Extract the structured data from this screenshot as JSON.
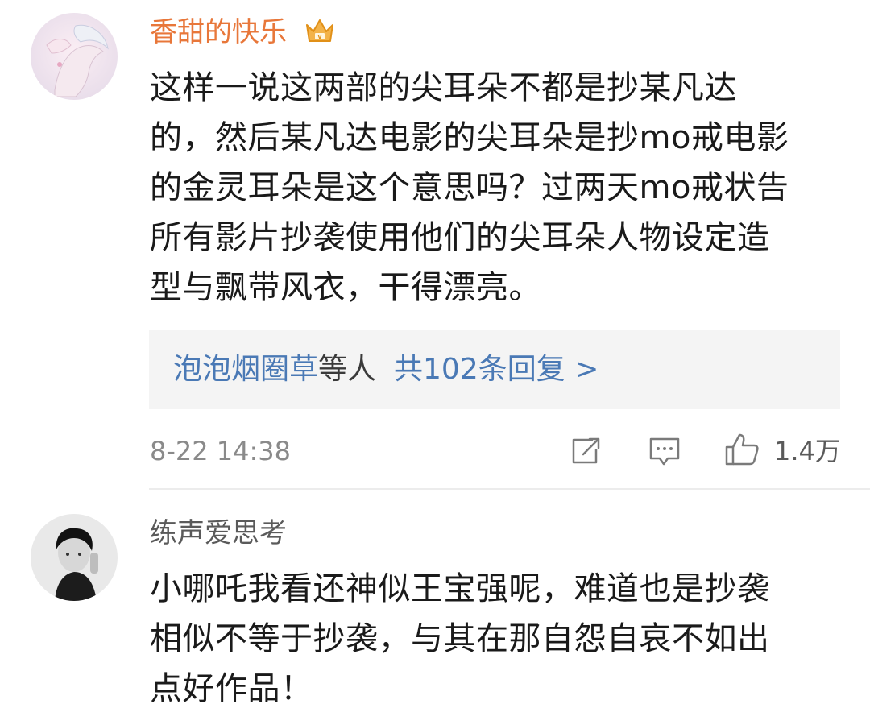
{
  "comments": [
    {
      "username": "香甜的快乐",
      "badge_icon": "crown-badge-icon",
      "lines": [
        "这样一说这两部的尖耳朵不都是抄某凡达",
        "的，然后某凡达电影的尖耳朵是抄mo戒电影",
        "的金灵耳朵是这个意思吗？过两天mo戒状告",
        "所有影片抄袭使用他们的尖耳朵人物设定造",
        "型与飘带风衣，干得漂亮。"
      ],
      "replies": {
        "reply_user": "泡泡烟圈草",
        "middle_text": "等人",
        "count_text": "共102条回复 >"
      },
      "timestamp": "8-22 14:38",
      "like_count": "1.4万"
    },
    {
      "username": "练声爱思考",
      "lines": [
        "小哪吒我看还神似王宝强呢，难道也是抄袭",
        "相似不等于抄袭，与其在那自怨自哀不如出",
        "点好作品！"
      ]
    }
  ],
  "colors": {
    "username_vip": "#e8773a",
    "username_normal": "#5a5a5a",
    "link_blue": "#4a79b5",
    "muted_gray": "#8a8a8a",
    "reply_bg": "#f4f4f4",
    "badge_gold": "#f0a020"
  }
}
